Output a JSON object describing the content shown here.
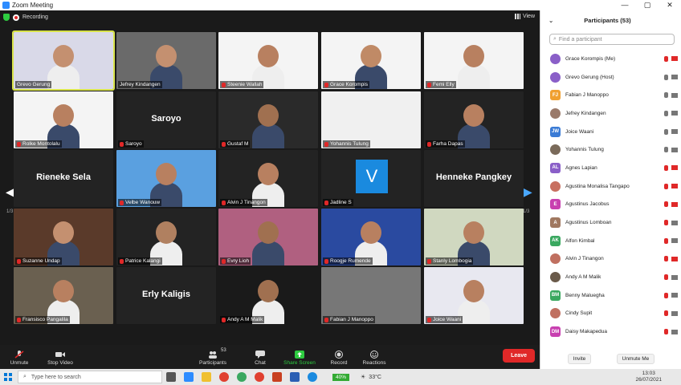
{
  "window": {
    "title": "Zoom Meeting",
    "minimize": "—",
    "maximize": "▢",
    "close": "✕"
  },
  "meeting": {
    "recording_label": "Recording",
    "view_label": "View",
    "page_left": "1/3",
    "page_right": "1/3"
  },
  "tiles": [
    {
      "name": "Grevo Gerung",
      "muted": false
    },
    {
      "name": "Jefrey Kindangen",
      "muted": false
    },
    {
      "name": "Steenie Wallah",
      "muted": true
    },
    {
      "name": "Grace Korompis",
      "muted": true
    },
    {
      "name": "Femi Elly",
      "muted": true
    },
    {
      "name": "Rolke Montolalu",
      "muted": true
    },
    {
      "name": "Saroyo",
      "muted": true,
      "big": "Saroyo"
    },
    {
      "name": "Gustaf M",
      "muted": true
    },
    {
      "name": "Yohannis Tulung",
      "muted": true
    },
    {
      "name": "Farha Dapas",
      "muted": true
    },
    {
      "name": "",
      "muted": true,
      "big": "Rieneke Sela"
    },
    {
      "name": "Velbe Wanouw",
      "muted": true
    },
    {
      "name": "Alvin J Tinangon",
      "muted": true
    },
    {
      "name": "Jadline S",
      "muted": true
    },
    {
      "name": "",
      "muted": true,
      "big": "Henneke Pangkey"
    },
    {
      "name": "Suzanne Undap",
      "muted": true
    },
    {
      "name": "Patrice Kalangi",
      "muted": true
    },
    {
      "name": "Evry Lioh",
      "muted": true
    },
    {
      "name": "Roogje Rumende",
      "muted": true
    },
    {
      "name": "Stanly Lombogia",
      "muted": true
    },
    {
      "name": "Fransisco Pangalila",
      "muted": true
    },
    {
      "name": "",
      "muted": true,
      "big": "Erly Kaligis"
    },
    {
      "name": "Andy A M Malik",
      "muted": true
    },
    {
      "name": "Fabian J Manoppo",
      "muted": true
    },
    {
      "name": "Joice Waani",
      "muted": true
    }
  ],
  "jadline_initial": "V",
  "toolbar": {
    "unmute": "Unmute",
    "stop_video": "Stop Video",
    "participants": "Participants",
    "participants_count": "53",
    "chat": "Chat",
    "share": "Share Screen",
    "record": "Record",
    "reactions": "Reactions",
    "leave": "Leave"
  },
  "panel": {
    "title": "Participants (53)",
    "find_placeholder": "Find a participant",
    "invite": "Invite",
    "unmute_me": "Unmute Me",
    "participants": [
      {
        "name": "Grace Korompis (Me)",
        "initials": "",
        "color": "#8a5fc8",
        "mic": "off",
        "cam": "off"
      },
      {
        "name": "Grevo Gerung (Host)",
        "initials": "",
        "color": "#8a5fc8",
        "mic": "on",
        "cam": "on"
      },
      {
        "name": "Fabian J Manoppo",
        "initials": "FJ",
        "color": "#f0a030",
        "mic": "on",
        "cam": "on"
      },
      {
        "name": "Jefrey Kindangen",
        "initials": "",
        "color": "#9a7a6a",
        "mic": "on",
        "cam": "on"
      },
      {
        "name": "Joice Waani",
        "initials": "JW",
        "color": "#3a7bd5",
        "mic": "on",
        "cam": "on"
      },
      {
        "name": "Yohannis Tulung",
        "initials": "",
        "color": "#7a6a5a",
        "mic": "on",
        "cam": "on"
      },
      {
        "name": "Agnes Lapian",
        "initials": "AL",
        "color": "#8a5fc8",
        "mic": "off",
        "cam": "off"
      },
      {
        "name": "Agustina Monalisa Tangapo",
        "initials": "",
        "color": "#c87060",
        "mic": "off",
        "cam": "off"
      },
      {
        "name": "Agustinus Jacobus",
        "initials": "E",
        "color": "#c840b0",
        "mic": "off",
        "cam": "off"
      },
      {
        "name": "Agustinus Lomboan",
        "initials": "A",
        "color": "#a07860",
        "mic": "off",
        "cam": "on"
      },
      {
        "name": "Alfon Kimbal",
        "initials": "AK",
        "color": "#3aa860",
        "mic": "off",
        "cam": "on"
      },
      {
        "name": "Alvin J Tinangon",
        "initials": "",
        "color": "#c07060",
        "mic": "off",
        "cam": "off"
      },
      {
        "name": "Andy A M Malik",
        "initials": "",
        "color": "#6a5a4a",
        "mic": "off",
        "cam": "on"
      },
      {
        "name": "Benny Maluegha",
        "initials": "BM",
        "color": "#3aa860",
        "mic": "off",
        "cam": "on"
      },
      {
        "name": "Cindy Supit",
        "initials": "",
        "color": "#c07060",
        "mic": "off",
        "cam": "on"
      },
      {
        "name": "Daisy Makapedua",
        "initials": "DM",
        "color": "#c840b0",
        "mic": "off",
        "cam": "on"
      }
    ]
  },
  "taskbar": {
    "search_placeholder": "Type here to search",
    "battery": "40%",
    "temperature": "33°C",
    "time": "13:03",
    "date": "26/07/2021"
  }
}
